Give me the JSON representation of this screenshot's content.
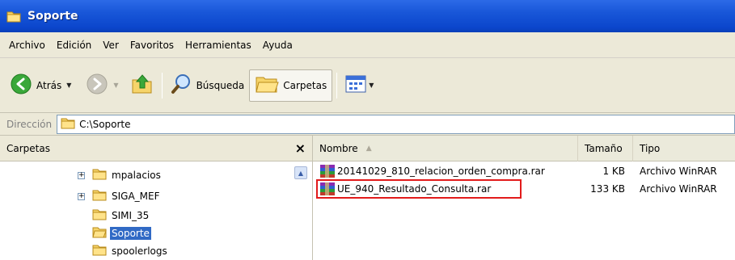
{
  "window": {
    "title": "Soporte"
  },
  "menu": [
    "Archivo",
    "Edición",
    "Ver",
    "Favoritos",
    "Herramientas",
    "Ayuda"
  ],
  "toolbar": {
    "back_label": "Atrás",
    "search_label": "Búsqueda",
    "folders_label": "Carpetas"
  },
  "address": {
    "label": "Dirección",
    "value": "C:\\Soporte"
  },
  "leftpane": {
    "title": "Carpetas",
    "close_glyph": "×",
    "tree": [
      {
        "label": "mpalacios",
        "expandable": true,
        "selected": false
      },
      {
        "label": "SIGA_MEF",
        "expandable": true,
        "selected": false
      },
      {
        "label": "SIMI_35",
        "expandable": false,
        "selected": false
      },
      {
        "label": "Soporte",
        "expandable": false,
        "selected": true
      },
      {
        "label": "spoolerlogs",
        "expandable": false,
        "selected": false
      }
    ]
  },
  "filelist": {
    "columns": {
      "name": "Nombre",
      "size": "Tamaño",
      "type": "Tipo"
    },
    "rows": [
      {
        "name": "20141029_810_relacion_orden_compra.rar",
        "size": "1 KB",
        "type": "Archivo WinRAR"
      },
      {
        "name": "UE_940_Resultado_Consulta.rar",
        "size": "133 KB",
        "type": "Archivo WinRAR"
      }
    ],
    "highlight_color": "#e21b1b"
  },
  "colors": {
    "titlebar": "#0b46cc",
    "chrome": "#ece9d8",
    "selection": "#316ac5"
  }
}
